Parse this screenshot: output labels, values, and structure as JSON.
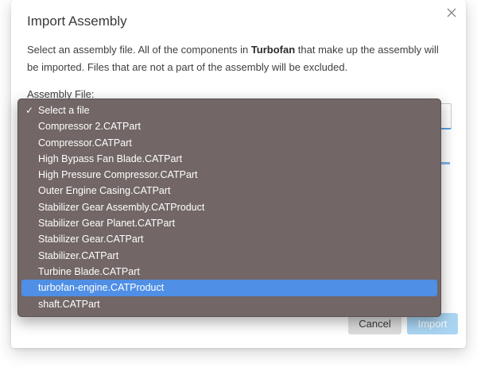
{
  "dialog": {
    "title": "Import Assembly",
    "description_before": "Select an assembly file. All of the components in ",
    "description_bold": "Turbofan",
    "description_after": " that make up the assembly will be imported. Files that are not a part of the assembly will be excluded.",
    "field_label": "Assembly File:",
    "cancel_label": "Cancel",
    "import_label": "Import"
  },
  "dropdown": {
    "selected_index": 0,
    "highlighted_index": 11,
    "options": [
      "Select a file",
      "Compressor 2.CATPart",
      "Compressor.CATPart",
      "High Bypass Fan Blade.CATPart",
      "High Pressure Compressor.CATPart",
      "Outer Engine Casing.CATPart",
      "Stabilizer Gear Assembly.CATProduct",
      "Stabilizer Gear Planet.CATPart",
      "Stabilizer Gear.CATPart",
      "Stabilizer.CATPart",
      "Turbine Blade.CATPart",
      "turbofan-engine.CATProduct",
      "shaft.CATPart"
    ],
    "check_glyph": "✓"
  },
  "progress": {
    "percent": 100
  },
  "colors": {
    "accent": "#4f8fe6",
    "dropdown_bg": "#726666",
    "import_disabled": "#a9d5f3"
  },
  "icons": {
    "close": "close-icon",
    "check": "checkmark-icon"
  }
}
